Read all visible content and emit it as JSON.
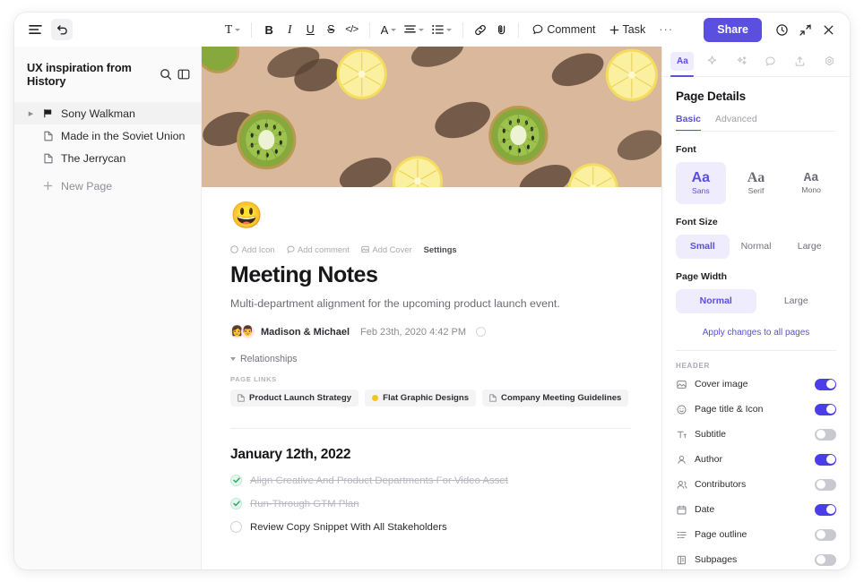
{
  "topbar": {
    "menu_icon": "hamburger-icon",
    "back_icon": "undo-arrow-icon",
    "tools": {
      "text_style": "T",
      "bold": "B",
      "italic": "I",
      "underline": "U",
      "strikethrough": "S",
      "code": "</>",
      "font_color": "A",
      "align": "align-icon",
      "list": "list-icon",
      "link": "link-icon",
      "note": "note-icon",
      "comment_label": "Comment",
      "task_label": "Task",
      "more_label": "···"
    },
    "share_label": "Share",
    "history_icon": "history-clock-icon",
    "collapse_icon": "collapse-arrows-icon",
    "close_icon": "close-x-icon"
  },
  "sidebar": {
    "title": "UX inspiration from History",
    "search_icon": "search-icon",
    "panel_icon": "sidebar-toggle-icon",
    "items": [
      {
        "label": "Sony Walkman",
        "icon": "flag-icon",
        "active": true,
        "muted": false,
        "expandable": true
      },
      {
        "label": "Made in the Soviet Union",
        "icon": "page-icon",
        "active": false,
        "muted": false,
        "expandable": false
      },
      {
        "label": "The Jerrycan",
        "icon": "page-icon",
        "active": false,
        "muted": false,
        "expandable": false
      },
      {
        "label": "New Page",
        "icon": "plus-icon",
        "active": false,
        "muted": true,
        "expandable": false
      }
    ]
  },
  "document": {
    "cover_alt": "cover-image-fruit-slices",
    "emoji": "😃",
    "meta_actions": [
      {
        "label": "Add Icon",
        "icon": "emoji-icon",
        "strong": false
      },
      {
        "label": "Add comment",
        "icon": "comment-icon",
        "strong": false
      },
      {
        "label": "Add Cover",
        "icon": "image-icon",
        "strong": false
      },
      {
        "label": "Settings",
        "icon": "",
        "strong": true
      }
    ],
    "title": "Meeting Notes",
    "subtitle": "Multi-department alignment for the upcoming product launch event.",
    "author": "Madison & Michael",
    "avatars": [
      "👩",
      "👨"
    ],
    "date": "Feb 23th, 2020  4:42 PM",
    "relationships_label": "Relationships",
    "page_links_label": "PAGE LINKS",
    "page_links": [
      {
        "label": "Product Launch Strategy",
        "icon": "page-icon"
      },
      {
        "label": "Flat Graphic Designs",
        "icon": "yellow-dot-icon"
      },
      {
        "label": "Company Meeting Guidelines",
        "icon": "page-icon"
      }
    ],
    "section_title": "January 12th, 2022",
    "todos": [
      {
        "label": "Align Creative And Product Departments For Video Asset",
        "done": true
      },
      {
        "label": "Run-Through GTM Plan",
        "done": true
      },
      {
        "label": "Review Copy Snippet With All Stakeholders",
        "done": false
      }
    ]
  },
  "right_panel": {
    "tabs": [
      {
        "name": "typography",
        "glyph": "Aa",
        "active": true
      },
      {
        "name": "magic",
        "glyph": "sparkle-icon",
        "active": false
      },
      {
        "name": "ai-stars",
        "glyph": "stars-icon",
        "active": false
      },
      {
        "name": "comments",
        "glyph": "comment-icon",
        "active": false
      },
      {
        "name": "share",
        "glyph": "share-upload-icon",
        "active": false
      },
      {
        "name": "settings",
        "glyph": "gear-icon",
        "active": false
      }
    ],
    "title": "Page Details",
    "subtabs": [
      {
        "label": "Basic",
        "active": true
      },
      {
        "label": "Advanced",
        "active": false
      }
    ],
    "font_label": "Font",
    "fonts": [
      {
        "sample": "Aa",
        "name": "Sans",
        "active": true
      },
      {
        "sample": "Aa",
        "name": "Serif",
        "active": false
      },
      {
        "sample": "Aa",
        "name": "Mono",
        "active": false
      }
    ],
    "font_size_label": "Font Size",
    "font_sizes": [
      {
        "label": "Small",
        "active": true
      },
      {
        "label": "Normal",
        "active": false
      },
      {
        "label": "Large",
        "active": false
      }
    ],
    "page_width_label": "Page Width",
    "page_widths": [
      {
        "label": "Normal",
        "active": true
      },
      {
        "label": "Large",
        "active": false
      }
    ],
    "apply_link": "Apply changes to all pages",
    "header_label": "HEADER",
    "header_toggles": [
      {
        "label": "Cover image",
        "icon": "image-icon",
        "on": true
      },
      {
        "label": "Page title & Icon",
        "icon": "smiley-icon",
        "on": true
      },
      {
        "label": "Subtitle",
        "icon": "subtitle-icon",
        "on": false
      },
      {
        "label": "Author",
        "icon": "person-icon",
        "on": true
      },
      {
        "label": "Contributors",
        "icon": "people-icon",
        "on": false
      },
      {
        "label": "Date",
        "icon": "calendar-icon",
        "on": true
      },
      {
        "label": "Page outline",
        "icon": "outline-icon",
        "on": false
      },
      {
        "label": "Subpages",
        "icon": "subpages-icon",
        "on": false
      }
    ]
  },
  "colors": {
    "accent": "#5b4fe0",
    "toggle_on": "#4a3ee8",
    "accent_bg": "#eeecfd",
    "cover_bg": "#d9b89b"
  }
}
